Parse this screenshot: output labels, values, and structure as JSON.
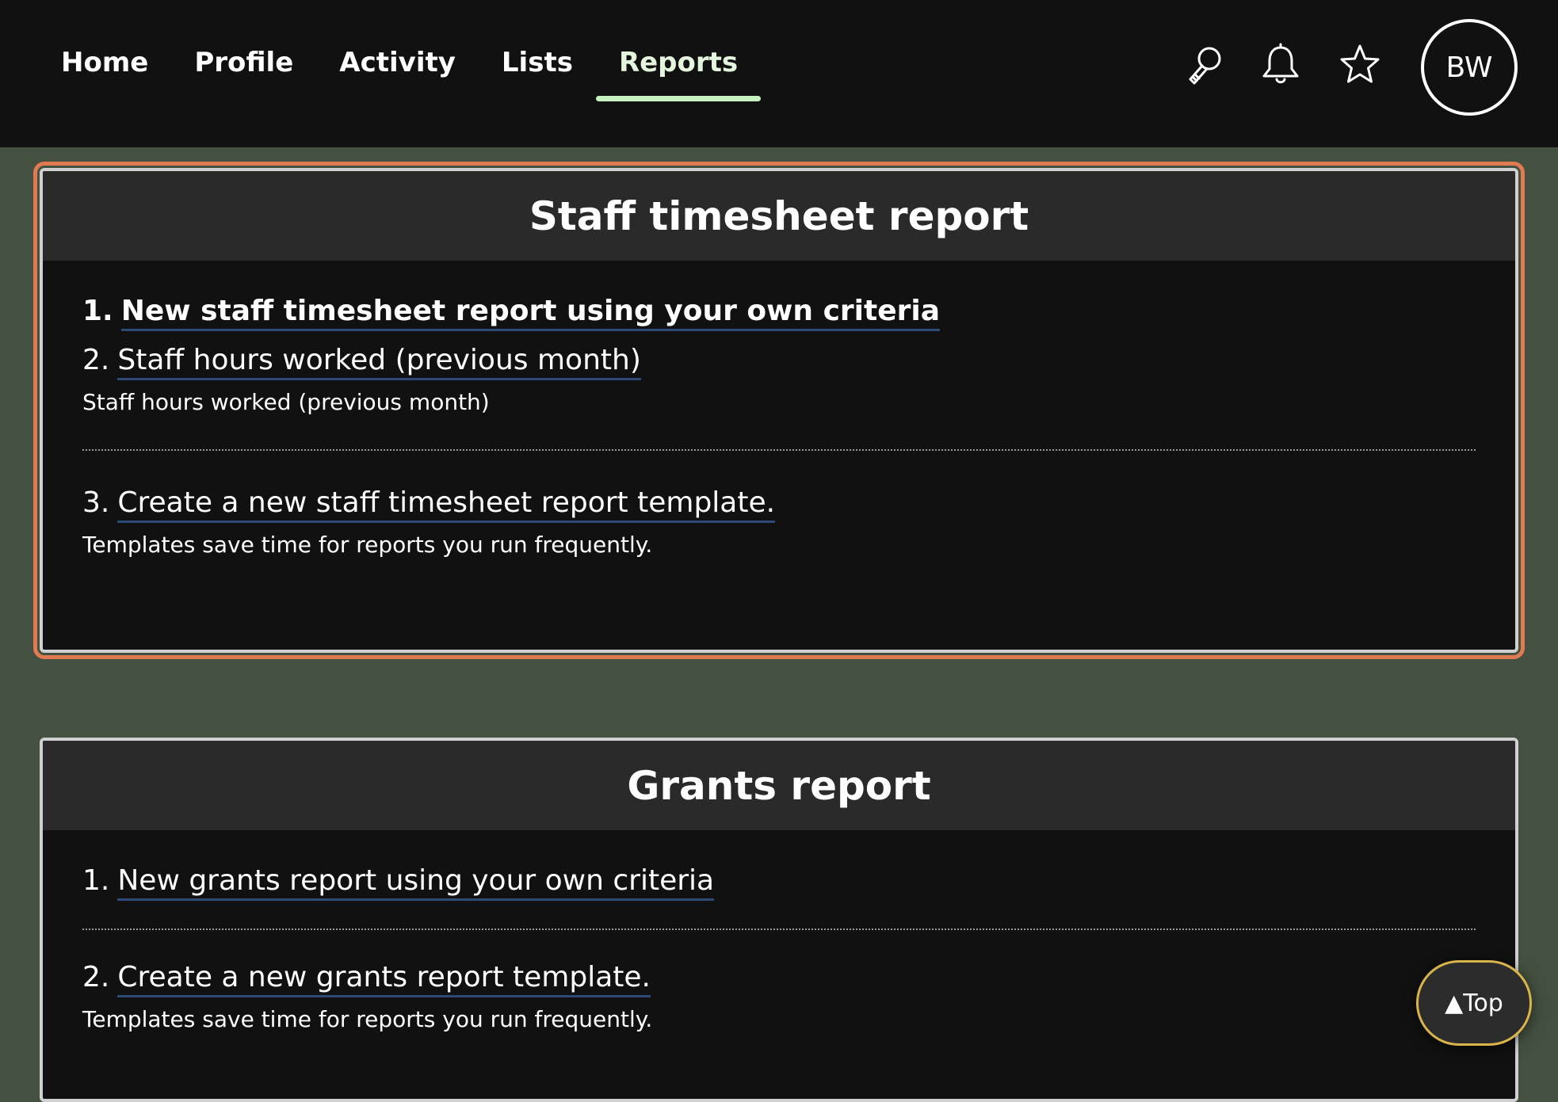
{
  "nav": {
    "items": [
      {
        "label": "Home"
      },
      {
        "label": "Profile"
      },
      {
        "label": "Activity"
      },
      {
        "label": "Lists"
      },
      {
        "label": "Reports",
        "active": true
      }
    ]
  },
  "header": {
    "icons": [
      "search-icon",
      "bell-icon",
      "star-icon"
    ],
    "avatar_initials": "BW"
  },
  "cards": [
    {
      "title": "Staff timesheet report",
      "items": [
        {
          "num": "1.",
          "label": "New staff timesheet report using your own criteria"
        },
        {
          "num": "2.",
          "label": "Staff hours worked (previous month)",
          "desc": "Staff hours worked (previous month)"
        },
        {
          "num": "3.",
          "label": "Create a new staff timesheet report template.",
          "desc": "Templates save time for reports you run frequently."
        }
      ]
    },
    {
      "title": "Grants report",
      "items": [
        {
          "num": "1.",
          "label": "New grants report using your own criteria"
        },
        {
          "num": "2.",
          "label": "Create a new grants report template.",
          "desc": "Templates save time for reports you run frequently."
        }
      ]
    }
  ],
  "top_button": {
    "label": "▲Top"
  },
  "colors": {
    "page_bg": "#445140",
    "header_bg": "#111111",
    "card_bg": "#111111",
    "card_header_bg": "#2a2a2a",
    "active_tab_underline": "#c6f2bf",
    "focus_outline": "#e07a50",
    "link_underline": "#2e4a78",
    "top_button_border": "#d9b44a"
  }
}
